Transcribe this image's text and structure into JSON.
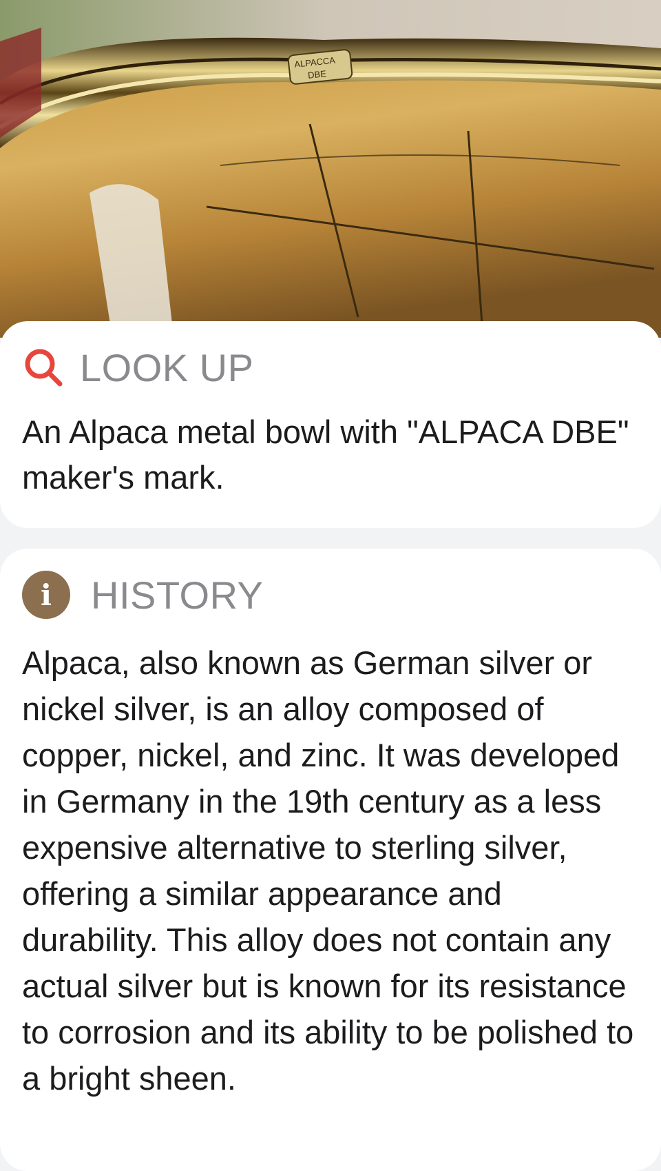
{
  "photo": {
    "stamp_line1": "ALPACCA",
    "stamp_line2": "DBE"
  },
  "lookup": {
    "icon": "search-icon",
    "title": "LOOK UP",
    "body": "An Alpaca metal bowl with \"ALPACA DBE\" maker's mark."
  },
  "history": {
    "icon": "info-icon",
    "icon_glyph": "i",
    "title": "HISTORY",
    "body": "Alpaca, also known as German silver or nickel silver, is an alloy composed of copper, nickel, and zinc. It was developed in Germany in the 19th century as a less expensive alternative to sterling silver, offering a similar appearance and durability. This alloy does not contain any actual silver but is known for its resistance to corrosion and its ability to be polished to a bright sheen."
  },
  "colors": {
    "search_icon": "#e8453c",
    "info_icon_bg": "#8b6f4e",
    "header_text": "#8a8a8e",
    "body_text": "#1c1c1e"
  }
}
